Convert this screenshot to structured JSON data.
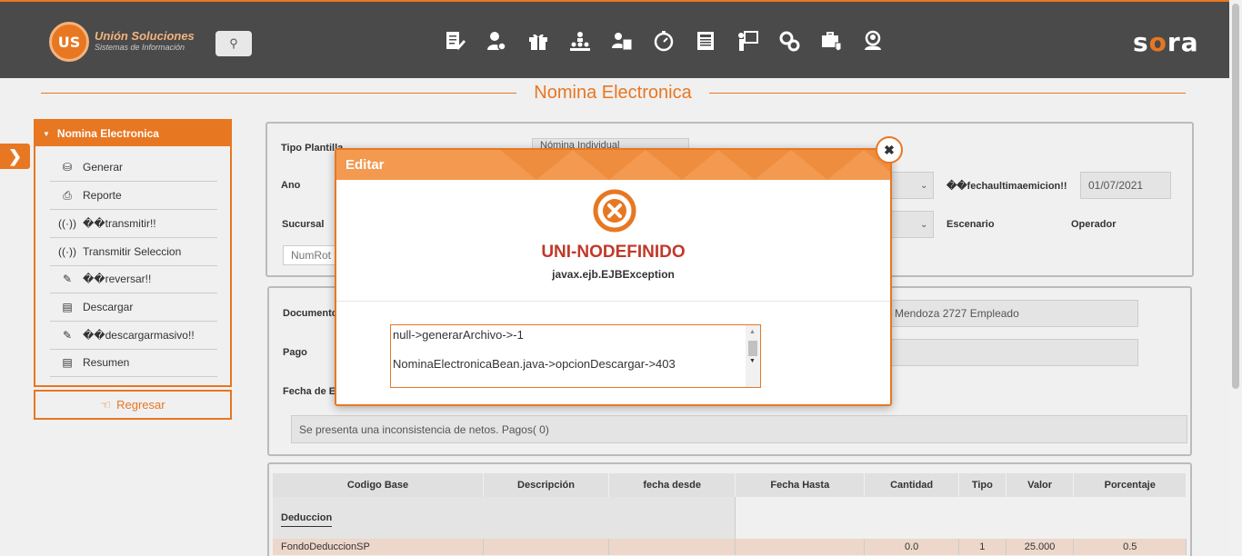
{
  "header": {
    "logo_mark": "US",
    "logo_line1": "Unión Soluciones",
    "logo_line2": "Sistemas de Información",
    "search_icon": "⚲",
    "brand": {
      "pre": "s",
      "o": "o",
      "post": "ra"
    },
    "nav_icons": [
      "document-edit-icon",
      "user-settings-icon",
      "gift-icon",
      "org-chart-icon",
      "user-id-icon",
      "stopwatch-icon",
      "newspaper-icon",
      "presentation-icon",
      "gears-icon",
      "medical-kit-icon",
      "magnifier-user-icon"
    ]
  },
  "page": {
    "title": "Nomina Electronica"
  },
  "sidebar": {
    "title": "Nomina Electronica",
    "items": [
      {
        "label": "Generar",
        "icon": "coins-icon"
      },
      {
        "label": "Reporte",
        "icon": "printer-icon"
      },
      {
        "label": "��transmitir!!",
        "icon": "antenna-icon"
      },
      {
        "label": "Transmitir Seleccion",
        "icon": "antenna-icon"
      },
      {
        "label": "��reversar!!",
        "icon": "eraser-icon"
      },
      {
        "label": "Descargar",
        "icon": "document-icon"
      },
      {
        "label": "��descargarmasivo!!",
        "icon": "eraser-icon"
      },
      {
        "label": "Resumen",
        "icon": "document-icon"
      }
    ],
    "back_label": "Regresar"
  },
  "form": {
    "tipo_plantilla_label": "Tipo Plantilla",
    "tipo_plantilla_value": "Nómina Individual",
    "ano_label": "Ano",
    "fecha_label": "��fechaultimaemicion!!",
    "fecha_value": "01/07/2021",
    "sucursal_label": "Sucursal",
    "escenario_label": "Escenario",
    "operador_label": "Operador",
    "numrot_placeholder": "NumRot"
  },
  "detail": {
    "documento_label": "Documento",
    "documento_value": "Mendoza 2727 Empleado",
    "pago_label": "Pago",
    "fecha_e_label": "Fecha de E",
    "message": "Se presenta una inconsistencia de netos. Pagos(                0)"
  },
  "table": {
    "headers": [
      "Codigo Base",
      "Descripción",
      "fecha desde",
      "Fecha Hasta",
      "Cantidad",
      "Tipo",
      "Valor",
      "Porcentaje"
    ],
    "group_label": "Deduccion",
    "row": [
      "FondoDeduccionSP",
      "",
      "",
      "",
      "0.0",
      "1",
      "25.000",
      "0.5"
    ]
  },
  "dialog": {
    "title": "Editar",
    "close": "✖",
    "error_code": "UNI-NODEFINIDO",
    "exception": "javax.ejb.EJBException",
    "lines": [
      "null->generarArchivo->-1",
      "NominaElectronicaBean.java->opcionDescargar->403"
    ]
  },
  "colors": {
    "accent": "#e87722",
    "header_bg": "#4a4a4a",
    "error": "#c0392b"
  }
}
